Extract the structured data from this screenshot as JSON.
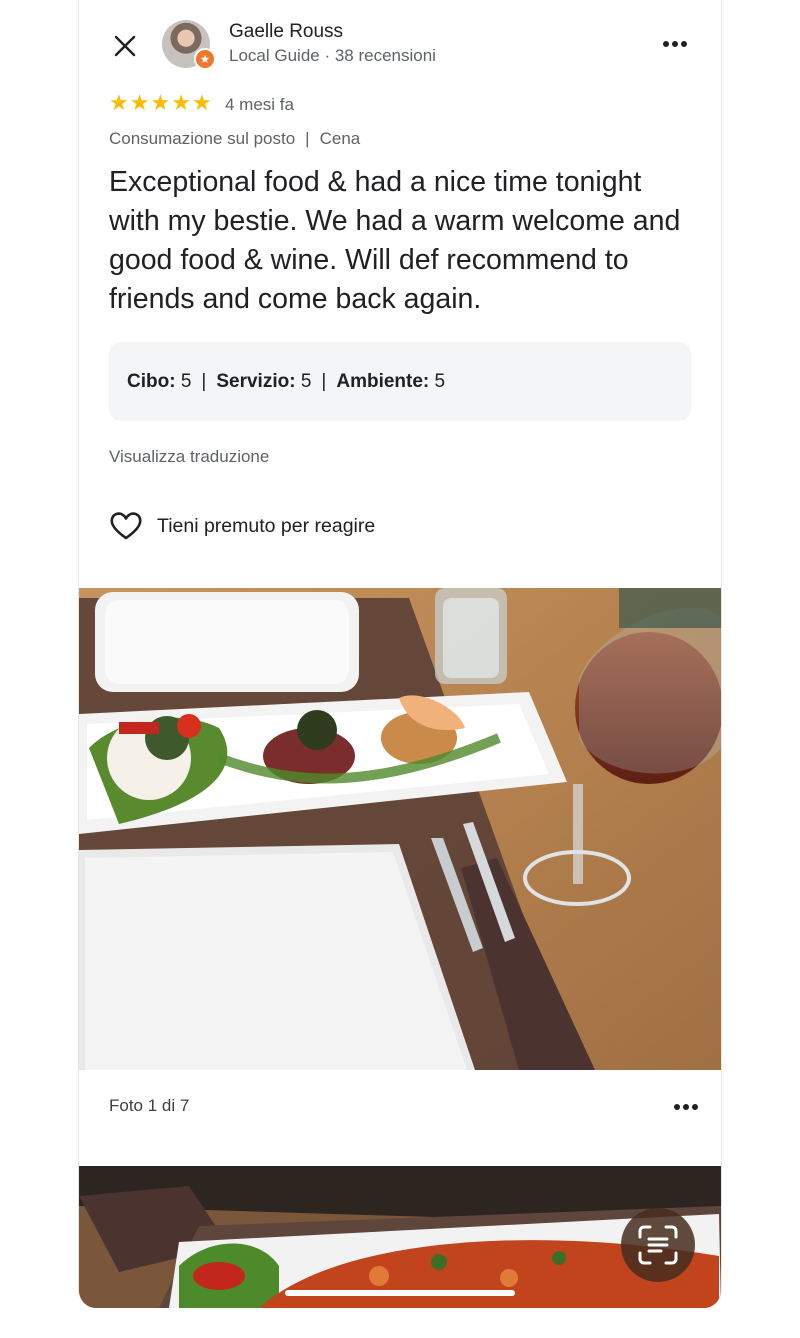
{
  "reviewer": {
    "name": "Gaelle Rouss",
    "meta": "Local Guide · 38 recensioni"
  },
  "icons": {
    "close": "close-icon",
    "more": "more-horiz-icon",
    "star": "star-icon",
    "heart": "heart-outline-icon",
    "lens": "google-lens-icon",
    "badge": "local-guide-star-icon"
  },
  "review": {
    "rating": 5,
    "time": "4 mesi fa",
    "visit_type": "Consumazione sul posto",
    "visit_separator": "|",
    "meal": "Cena",
    "text": "Exceptional food & had a nice time tonight with my bestie. We had a warm welcome and good food & wine. Will def recommend to friends and come back again."
  },
  "ratings": {
    "food_label": "Cibo:",
    "food_value": "5",
    "service_label": "Servizio:",
    "service_value": "5",
    "ambience_label": "Ambiente:",
    "ambience_value": "5",
    "separator": "|"
  },
  "translate_label": "Visualizza traduzione",
  "react_label": "Tieni premuto per reagire",
  "photo": {
    "counter": "Foto 1 di 7"
  },
  "colors": {
    "star": "#fbbc04",
    "badge": "#f0772b",
    "text_primary": "#202124",
    "text_secondary": "#5f6368",
    "ratings_bg": "#f4f5f7"
  }
}
